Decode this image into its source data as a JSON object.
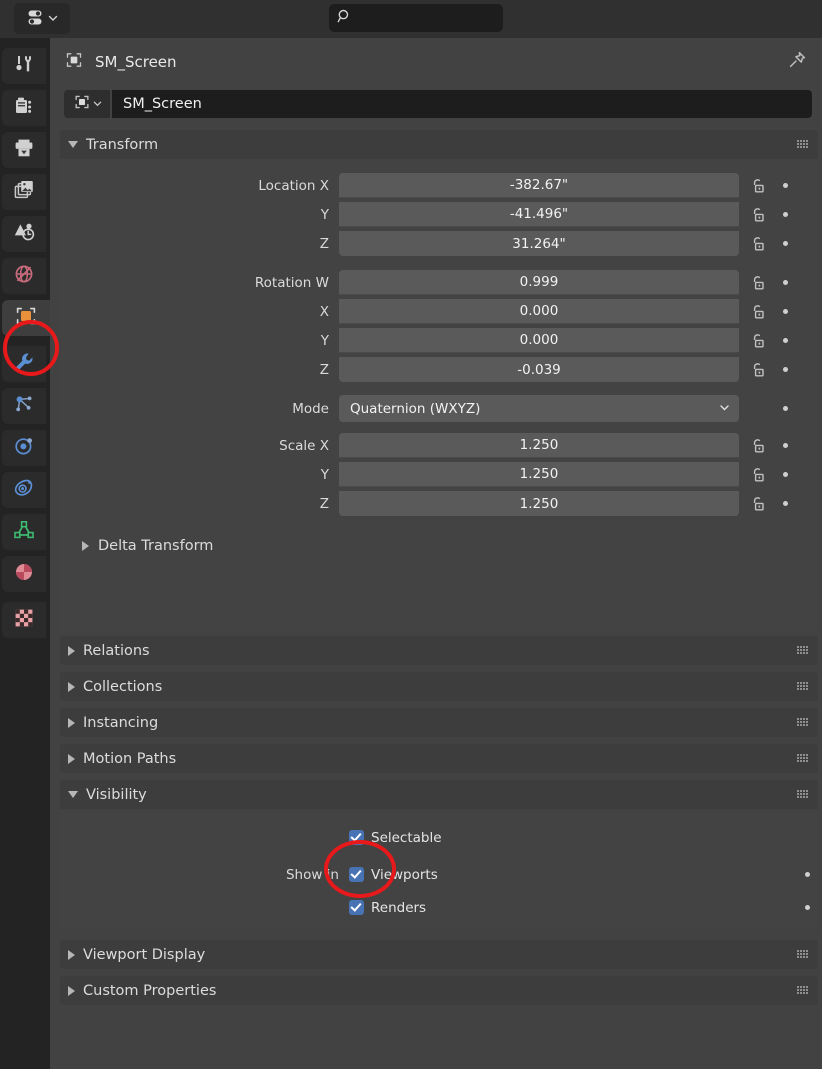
{
  "editor": {
    "type_icon": "properties-editor-icon",
    "chevron_icon": "chevron-down-icon"
  },
  "search": {
    "icon": "search-icon",
    "value": "",
    "placeholder": ""
  },
  "tabs": [
    {
      "id": "tool",
      "name": "tool-icon",
      "active": false
    },
    {
      "id": "render",
      "name": "render-camera-icon",
      "active": false
    },
    {
      "id": "output",
      "name": "output-printer-icon",
      "active": false
    },
    {
      "id": "view-layer",
      "name": "view-layer-images-icon",
      "active": false
    },
    {
      "id": "scene",
      "name": "scene-icon",
      "active": false
    },
    {
      "id": "world",
      "name": "world-globe-icon",
      "active": false
    },
    {
      "id": "object",
      "name": "object-icon",
      "active": true
    },
    {
      "id": "modifiers",
      "name": "wrench-icon",
      "active": false
    },
    {
      "id": "particles",
      "name": "particles-icon",
      "active": false
    },
    {
      "id": "physics",
      "name": "physics-orbit-icon",
      "active": false
    },
    {
      "id": "constraints",
      "name": "constraints-icon",
      "active": false
    },
    {
      "id": "object-data",
      "name": "mesh-data-icon",
      "active": false
    },
    {
      "id": "material",
      "name": "material-sphere-icon",
      "active": false
    },
    {
      "id": "texture",
      "name": "texture-checker-icon",
      "active": false
    }
  ],
  "breadcrumb": {
    "icon": "object-icon",
    "label": "SM_Screen"
  },
  "header": {
    "pin_icon": "pin-icon"
  },
  "id_block": {
    "selector_icon": "object-icon",
    "chevron_icon": "chevron-down-icon",
    "name": "SM_Screen"
  },
  "panels": {
    "transform": {
      "title": "Transform",
      "expanded": true,
      "grip": "drag-grip-icon",
      "location": {
        "labels": [
          "Location X",
          "Y",
          "Z"
        ],
        "values": [
          "-382.67\"",
          "-41.496\"",
          "31.264\""
        ]
      },
      "rotation": {
        "labels": [
          "Rotation W",
          "X",
          "Y",
          "Z"
        ],
        "values": [
          "0.999",
          "0.000",
          "0.000",
          "-0.039"
        ]
      },
      "mode": {
        "label": "Mode",
        "value": "Quaternion (WXYZ)"
      },
      "scale": {
        "labels": [
          "Scale X",
          "Y",
          "Z"
        ],
        "values": [
          "1.250",
          "1.250",
          "1.250"
        ]
      },
      "delta_transform": {
        "label": "Delta Transform",
        "expanded": false
      }
    },
    "relations": {
      "title": "Relations",
      "expanded": false,
      "grip": "drag-grip-icon"
    },
    "collections": {
      "title": "Collections",
      "expanded": false,
      "grip": "drag-grip-icon"
    },
    "instancing": {
      "title": "Instancing",
      "expanded": false,
      "grip": "drag-grip-icon"
    },
    "motion_paths": {
      "title": "Motion Paths",
      "expanded": false,
      "grip": "drag-grip-icon"
    },
    "visibility": {
      "title": "Visibility",
      "expanded": true,
      "grip": "drag-grip-icon",
      "selectable": {
        "label": "Selectable",
        "checked": true
      },
      "show_in_label": "Show in",
      "viewports": {
        "label": "Viewports",
        "checked": true
      },
      "renders": {
        "label": "Renders",
        "checked": true
      }
    },
    "viewport_display": {
      "title": "Viewport Display",
      "expanded": false,
      "grip": "drag-grip-icon"
    },
    "custom_properties": {
      "title": "Custom Properties",
      "expanded": false,
      "grip": "drag-grip-icon"
    }
  },
  "annotations": {
    "color": "#e8191b",
    "items": [
      {
        "name": "annotation-circle-object-tab",
        "target": "object-properties-tab"
      },
      {
        "name": "annotation-circle-renders-checkbox",
        "target": "renders-checkbox"
      }
    ]
  },
  "icons": {
    "lock": "unlocked-padlock-icon",
    "animate": "animate-decorator-dot-icon"
  }
}
